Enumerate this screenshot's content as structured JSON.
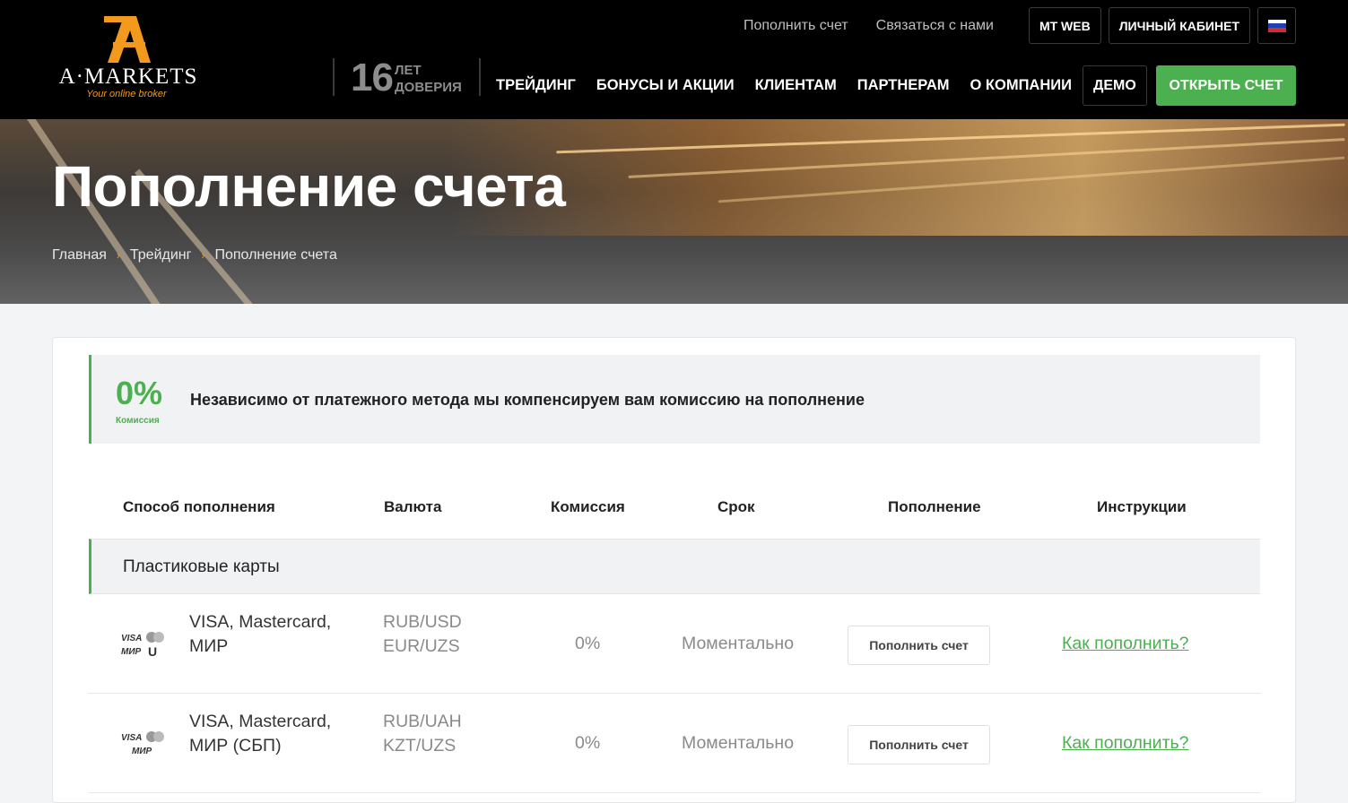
{
  "brand": {
    "name": "A·MARKETS",
    "tagline": "Your online broker",
    "accent_color": "#f39a1e",
    "green_color": "#4caf50"
  },
  "top_bar": {
    "links": [
      "Пополнить счет",
      "Связаться с нами"
    ],
    "buttons": [
      "MT WEB",
      "ЛИЧНЫЙ КАБИНЕТ"
    ],
    "language_flag": "flag-ru-icon"
  },
  "years_badge": {
    "number": "16",
    "line1": "ЛЕТ",
    "line2": "ДОВЕРИЯ"
  },
  "main_nav": {
    "items": [
      "ТРЕЙДИНГ",
      "БОНУСЫ И АКЦИИ",
      "КЛИЕНТАМ",
      "ПАРТНЕРАМ",
      "О КОМПАНИИ"
    ],
    "demo_label": "ДЕМО",
    "open_account_label": "ОТКРЫТЬ СЧЕТ"
  },
  "hero": {
    "title": "Пополнение счета",
    "breadcrumb": [
      "Главная",
      "Трейдинг",
      "Пополнение счета"
    ]
  },
  "notice": {
    "percent": "0%",
    "percent_label": "Комиссия",
    "text": "Независимо от платежного метода мы компенсируем вам комиссию на пополнение"
  },
  "table": {
    "headers": [
      "Способ пополнения",
      "Валюта",
      "Комиссия",
      "Срок",
      "Пополнение",
      "Инструкции"
    ],
    "group_label": "Пластиковые карты",
    "rows": [
      {
        "icon": "visa-mastercard-mir-unionpay-icon",
        "name_line1": "VISA, Mastercard,",
        "name_line2": "МИР",
        "currency_line1": "RUB/USD",
        "currency_line2": "EUR/UZS",
        "fee": "0%",
        "time": "Моментально",
        "button": "Пополнить счет",
        "link": "Как пополнить?"
      },
      {
        "icon": "visa-mastercard-mir-icon",
        "name_line1": "VISA, Mastercard,",
        "name_line2": "МИР (СБП)",
        "currency_line1": "RUB/UAH",
        "currency_line2": "KZT/UZS",
        "fee": "0%",
        "time": "Моментально",
        "button": "Пополнить счет",
        "link": "Как пополнить?"
      }
    ]
  }
}
